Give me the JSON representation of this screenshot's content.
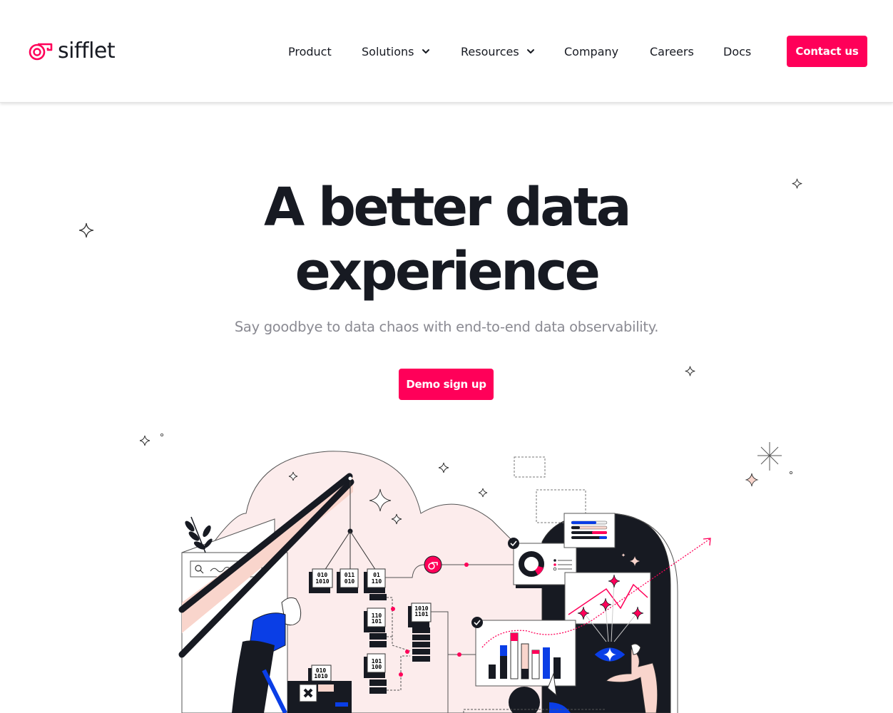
{
  "brand": {
    "name": "sifflet",
    "accent_color": "#ff0059",
    "text_color": "#171a22",
    "logo_icon": "whistle-logo-icon"
  },
  "nav": {
    "items": [
      {
        "label": "Product",
        "has_dropdown": false
      },
      {
        "label": "Solutions",
        "has_dropdown": true,
        "icon": "chevron-down-icon"
      },
      {
        "label": "Resources",
        "has_dropdown": true,
        "icon": "chevron-down-icon"
      },
      {
        "label": "Company",
        "has_dropdown": false
      },
      {
        "label": "Careers",
        "has_dropdown": false
      },
      {
        "label": "Docs",
        "has_dropdown": false
      }
    ],
    "cta_label": "Contact us"
  },
  "hero": {
    "title_line1": "A better data",
    "title_line2": "experience",
    "subtitle": "Say goodbye to data chaos with end-to-end data observability.",
    "cta_label": "Demo sign up"
  },
  "illustration": {
    "description": "data observability illustration",
    "binary_blocks": [
      "010\n1010",
      "011\n010",
      "01\n110",
      "110\n101",
      "1010\n1101",
      "101\n100",
      "010\n1010"
    ],
    "colors": {
      "pink_bg": "#fcecec",
      "peach": "#f9d5cc",
      "blue": "#0a3ee6",
      "dark": "#171a22",
      "accent": "#ff0059"
    }
  }
}
